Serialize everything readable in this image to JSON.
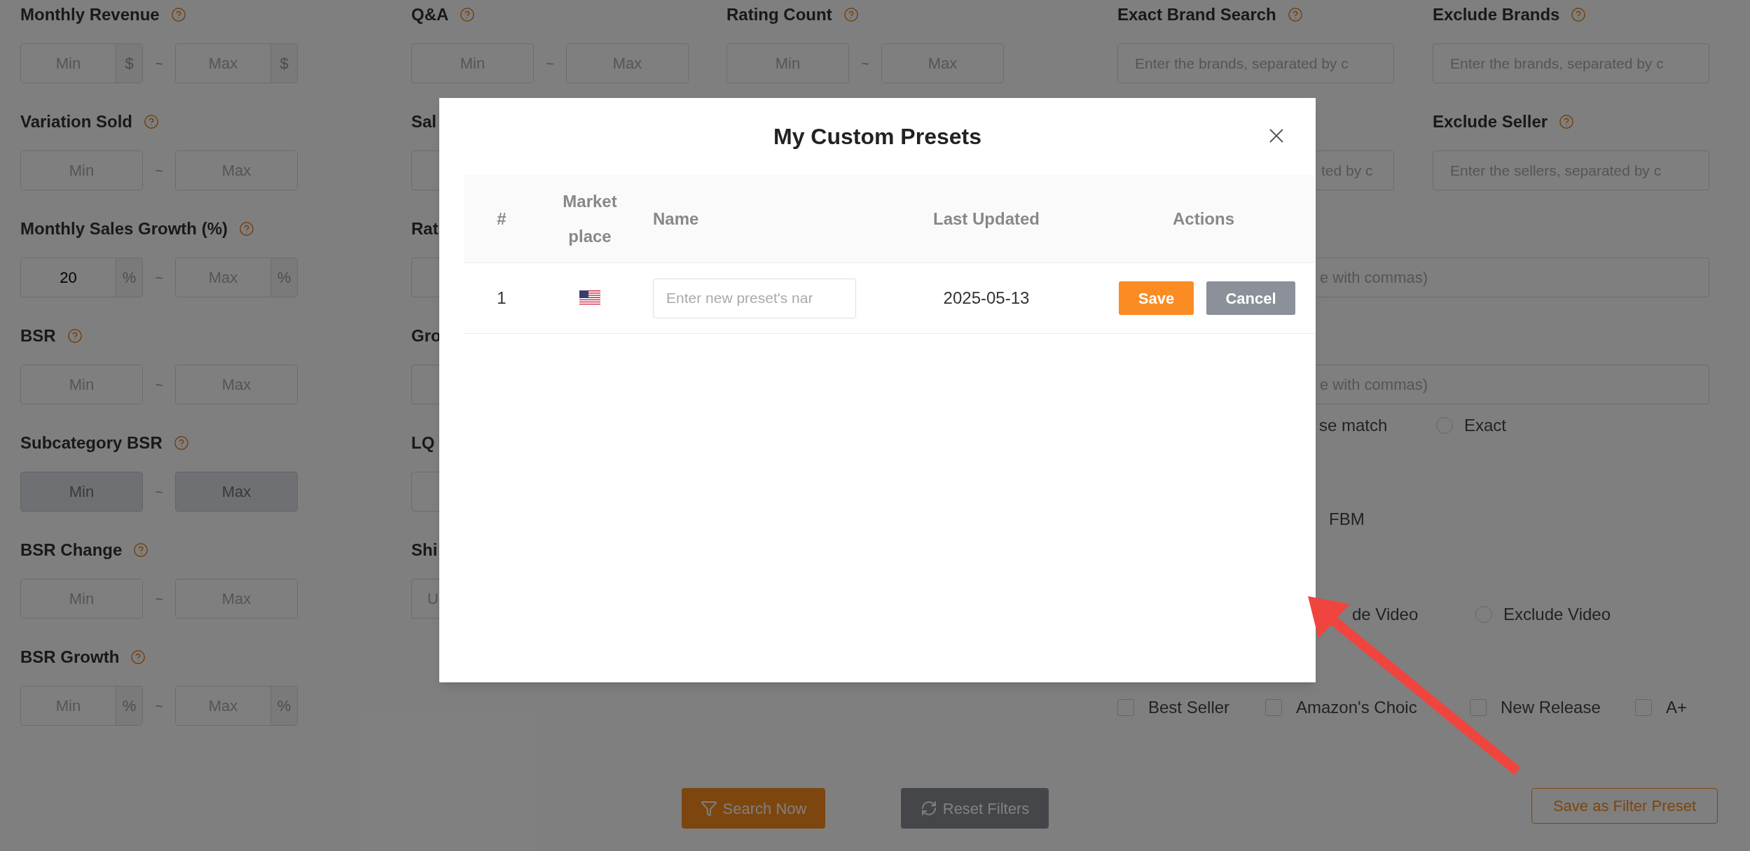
{
  "filters_left": [
    {
      "label": "Monthly Revenue",
      "min": {
        "placeholder": "Min",
        "unit": "$"
      },
      "separator": "~",
      "max": {
        "placeholder": "Max",
        "unit": "$"
      },
      "disabled": false
    },
    {
      "label": "Variation Sold",
      "min": {
        "placeholder": "Min"
      },
      "separator": "~",
      "max": {
        "placeholder": "Max"
      },
      "disabled": false
    },
    {
      "label": "Monthly Sales Growth (%)",
      "min": {
        "value": "20",
        "unit": "%"
      },
      "separator": "~",
      "max": {
        "placeholder": "Max",
        "unit": "%"
      },
      "disabled": false
    },
    {
      "label": "BSR",
      "min": {
        "placeholder": "Min"
      },
      "separator": "~",
      "max": {
        "placeholder": "Max"
      },
      "disabled": false
    },
    {
      "label": "Subcategory BSR",
      "min": {
        "placeholder": "Min"
      },
      "separator": "~",
      "max": {
        "placeholder": "Max"
      },
      "disabled": true
    },
    {
      "label": "BSR Change",
      "min": {
        "placeholder": "Min"
      },
      "separator": "~",
      "max": {
        "placeholder": "Max"
      },
      "disabled": false
    },
    {
      "label": "BSR Growth",
      "min": {
        "placeholder": "Min",
        "unit": "%"
      },
      "separator": "~",
      "max": {
        "placeholder": "Max",
        "unit": "%"
      },
      "disabled": false
    }
  ],
  "filters_middle": [
    {
      "label": "Q&A",
      "min": {
        "placeholder": "Min"
      },
      "separator": "~",
      "max": {
        "placeholder": "Max"
      },
      "disabled": false
    },
    {
      "label": "Sal"
    },
    {
      "label": "Rat"
    },
    {
      "label": "Gro"
    },
    {
      "label": "LQ"
    },
    {
      "label": "Shi",
      "placeholder": "U"
    }
  ],
  "rating_count": {
    "label": "Rating Count",
    "min": {
      "placeholder": "Min"
    },
    "separator": "~",
    "max": {
      "placeholder": "Max"
    },
    "disabled": false
  },
  "brand_filters": [
    {
      "label": "Exact Brand Search",
      "placeholder": "Enter the brands, separated by c"
    },
    {
      "label": "Exclude Brands",
      "placeholder": "Enter the brands, separated by c"
    }
  ],
  "seller_field_fragment": "ted by c",
  "exclude_seller": {
    "label": "Exclude Seller",
    "placeholder": "Enter the sellers, separated by c"
  },
  "keyword_field_fragments": [
    "e with commas)",
    "e with commas)"
  ],
  "match_fragment": "se match",
  "exact_option": {
    "label": "Exact",
    "selected": false
  },
  "fulfillment_fragment": "FBM",
  "video_fragment": "de Video",
  "exclude_video": {
    "label": "Exclude Video",
    "selected": false
  },
  "badges": [
    {
      "label": "Best Seller",
      "checked": false
    },
    {
      "label": "Amazon's Choic",
      "checked": false
    },
    {
      "label": "New Release",
      "checked": false
    },
    {
      "label": "A+",
      "checked": false
    }
  ],
  "actions": {
    "search": "Search Now",
    "reset": "Reset Filters",
    "save_preset": "Save as Filter Preset"
  },
  "modal": {
    "title": "My Custom Presets",
    "columns": [
      "#",
      "Marketplace",
      "Name",
      "Last Updated",
      "Actions"
    ],
    "rows": [
      {
        "index": "1",
        "name_placeholder": "Enter new preset's nar",
        "last_updated": "2025-05-13",
        "save": "Save",
        "cancel": "Cancel"
      }
    ]
  }
}
